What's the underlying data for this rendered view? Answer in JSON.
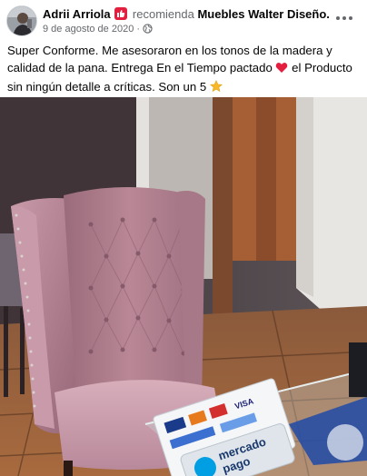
{
  "post": {
    "author_name": "Adrii Arriola",
    "recommends_text": "recomienda",
    "page_name": "Muebles Walter Diseño.",
    "date": "9 de agosto de 2020",
    "separator": "·",
    "more_icon": "more-horizontal-icon",
    "privacy_icon": "globe-icon",
    "review_badge_icon": "recommendation-badge-icon",
    "review_text_part1": "Super Conforme. Me asesoraron en los tonos de la madera y calidad de la pana. Entrega En el Tiempo pactado",
    "review_text_part2": "el Producto sin ningún detalle a críticas. Son un 5",
    "heart_emoji": "heart-icon",
    "star_emoji": "star-icon"
  },
  "photo": {
    "subject": "pink-tufted-chair-photo",
    "card_text_1": "mercado",
    "card_text_2": "pago",
    "card_brand_visa": "VISA"
  },
  "colors": {
    "badge_red": "#e41e3f",
    "muted_text": "#65676b",
    "heart_red": "#e41e3f",
    "star_yellow": "#f7b928",
    "mercadopago_blue": "#009ee3"
  }
}
